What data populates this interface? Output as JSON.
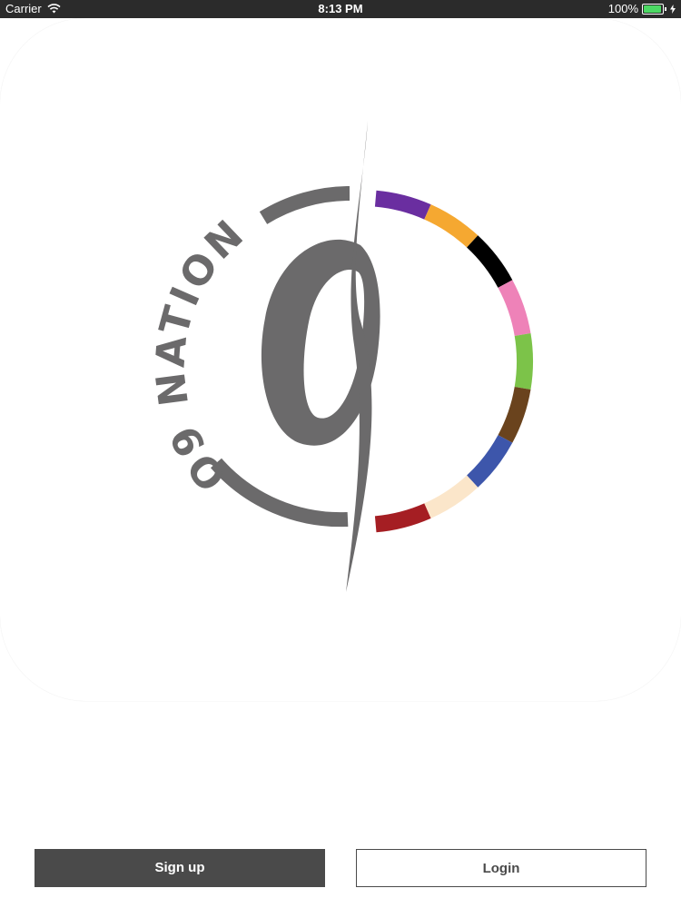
{
  "status_bar": {
    "carrier": "Carrier",
    "time": "8:13 PM",
    "battery": "100%",
    "battery_level": 1.0
  },
  "logo": {
    "text": "O9 NATION",
    "icon": "o9-nation-logo",
    "colors": {
      "gray": "#6b6a6b",
      "segments": [
        "#6a2ea0",
        "#f5a831",
        "#000000",
        "#ee82b8",
        "#7cc349",
        "#6a431d",
        "#3d56ab",
        "#fbe6ca",
        "#a51e23"
      ]
    }
  },
  "actions": {
    "signup_label": "Sign up",
    "login_label": "Login"
  },
  "colors": {
    "status_bar_bg": "#2b2b2b",
    "signup_bg": "#4a4a4a",
    "login_border": "#4a4a4a",
    "battery_green": "#4cd964"
  }
}
